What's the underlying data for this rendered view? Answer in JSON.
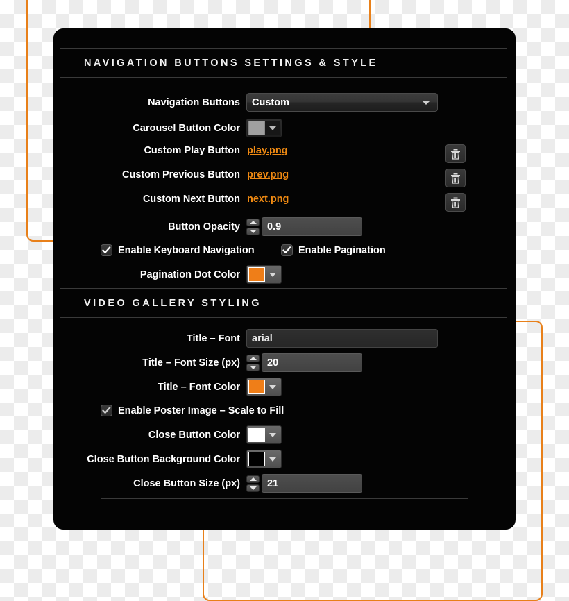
{
  "panel": {
    "sections": [
      {
        "title": "NAVIGATION BUTTONS SETTINGS & STYLE",
        "fields": {
          "navigation_buttons": {
            "label": "Navigation Buttons",
            "value": "Custom"
          },
          "carousel_button_color": {
            "label": "Carousel Button Color",
            "color": "#a0a0a0"
          },
          "custom_play_button": {
            "label": "Custom Play Button",
            "file": "play.png"
          },
          "custom_previous_button": {
            "label": "Custom Previous Button",
            "file": "prev.png"
          },
          "custom_next_button": {
            "label": "Custom Next Button",
            "file": "next.png"
          },
          "button_opacity": {
            "label": "Button Opacity",
            "value": "0.9"
          },
          "enable_keyboard_navigation": {
            "label": "Enable Keyboard Navigation",
            "checked": true
          },
          "enable_pagination": {
            "label": "Enable Pagination",
            "checked": true
          },
          "pagination_dot_color": {
            "label": "Pagination Dot Color",
            "color": "#ef7e18"
          }
        }
      },
      {
        "title": "VIDEO GALLERY STYLING",
        "fields": {
          "title_font": {
            "label": "Title – Font",
            "value": "arial"
          },
          "title_font_size": {
            "label": "Title – Font Size (px)",
            "value": "20"
          },
          "title_font_color": {
            "label": "Title – Font Color",
            "color": "#ef7e18"
          },
          "enable_poster_image": {
            "label": "Enable Poster Image – Scale to Fill",
            "checked": true
          },
          "close_button_color": {
            "label": "Close Button Color",
            "color": "#ffffff"
          },
          "close_button_background_color": {
            "label": "Close Button Background Color",
            "color": "#000000"
          },
          "close_button_size": {
            "label": "Close Button Size (px)",
            "value": "21"
          }
        }
      }
    ],
    "icons": {
      "trash": "trash-icon",
      "dropdown": "chevron-down-icon",
      "checkmark": "check-icon"
    }
  },
  "theme": {
    "accent": "#ef7e18",
    "panel_bg": "#040404",
    "frame_border": "#e8801a"
  }
}
